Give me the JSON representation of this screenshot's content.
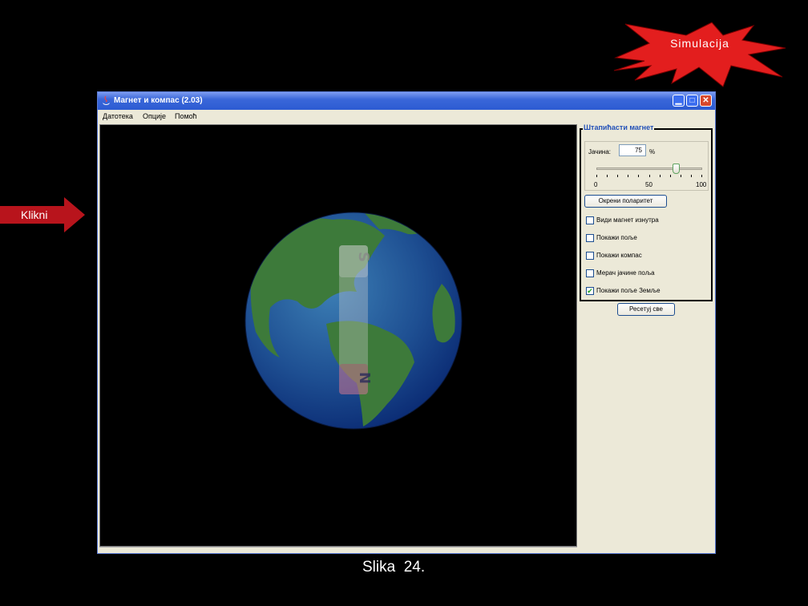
{
  "callouts": {
    "simulation": "Simulacija",
    "click": "Klikni"
  },
  "window": {
    "title": "Магнет и компас (2.03)",
    "menu": [
      "Датотека",
      "Опције",
      "Помоћ"
    ]
  },
  "canvas": {
    "magnet": {
      "top_pole": "S",
      "bottom_pole": "N"
    }
  },
  "panel": {
    "title": "Штапићасти магнет",
    "strength_label": "Јачина:",
    "strength_value": "75",
    "strength_unit": "%",
    "slider": {
      "min": "0",
      "mid": "50",
      "max": "100",
      "value": 75
    },
    "reverse_button": "Окрени поларитет",
    "checkboxes": [
      {
        "label": "Види магнет изнутра",
        "checked": false
      },
      {
        "label": "Покажи поље",
        "checked": false
      },
      {
        "label": "Покажи компас",
        "checked": false
      },
      {
        "label": "Мерач јачине поља",
        "checked": false
      },
      {
        "label": "Покажи поље Земље",
        "checked": true
      }
    ]
  },
  "reset_button": "Ресетуј све",
  "caption": "Slika  24.",
  "colors": {
    "titlebar": "#2c5bd2",
    "window_bg": "#ECE9D8",
    "callout_red": "#e31e1e",
    "panel_title": "#2250b8"
  }
}
